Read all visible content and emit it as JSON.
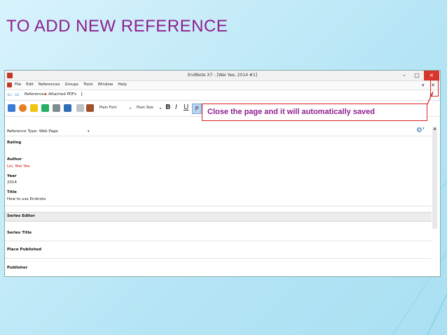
{
  "slide": {
    "title": "TO ADD NEW REFERENCE",
    "callout": "Close the page and it will automatically saved"
  },
  "window": {
    "title": "EndNote X7 - [Wai Yee, 2014 #1]",
    "minimize": "–",
    "maximize": "□",
    "close": "×"
  },
  "menu": {
    "items": [
      "File",
      "Edit",
      "References",
      "Groups",
      "Tools",
      "Window",
      "Help"
    ],
    "right": [
      "▾",
      "✕"
    ]
  },
  "tabs": {
    "reference": "Reference",
    "attached_pdfs": "Attached PDFs",
    "attach_icon": "paperclip-icon"
  },
  "toolbar": {
    "font": "Plain Font",
    "size": "Plain Size",
    "bold": "B",
    "italic": "I",
    "underline": "U",
    "plain": "P"
  },
  "reference": {
    "type_label": "Reference Type:",
    "type_value": "Web Page",
    "fields": [
      {
        "label": "Rating",
        "value": "· · · · ·"
      },
      {
        "label": "Author",
        "value": "Loi, Wai Yee"
      },
      {
        "label": "Year",
        "value": "2014"
      },
      {
        "label": "Title",
        "value": "How to use Endnote"
      },
      {
        "label": "Series Editor",
        "value": ""
      },
      {
        "label": "Series Title",
        "value": ""
      },
      {
        "label": "Place Published",
        "value": ""
      },
      {
        "label": "Publisher",
        "value": ""
      }
    ]
  },
  "colors": {
    "accent": "#8e1f8f",
    "highlight": "#dd2222",
    "background": "#bfe9f7"
  }
}
